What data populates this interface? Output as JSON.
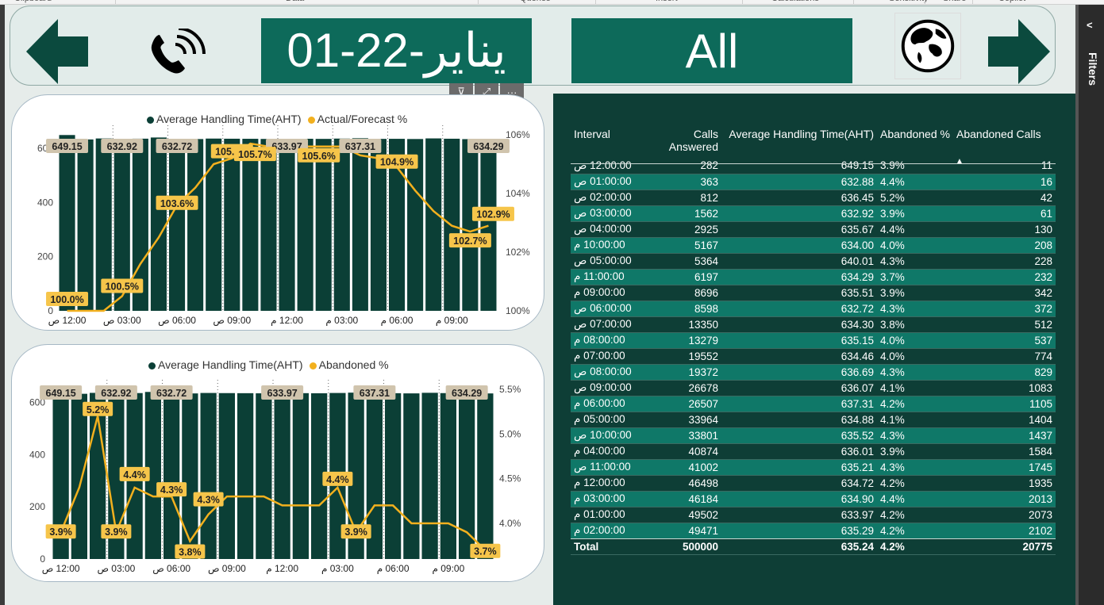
{
  "ribbon": {
    "items": [
      "Clipboard",
      "Data",
      "Queries",
      "Insert",
      "Calculations",
      "Sensitivity",
      "Share",
      "Copilot"
    ]
  },
  "filters_pane": {
    "label": "Filters",
    "chevron": "<"
  },
  "header": {
    "date_text": "يناير-22-01",
    "region_text": "All",
    "icons": {
      "back": "left-arrow-icon",
      "forward": "right-arrow-icon",
      "phone": "phone-icon",
      "globe": "globe-icon"
    }
  },
  "visual_toolbar": {
    "items": [
      {
        "name": "filter-icon",
        "glyph": "⊽"
      },
      {
        "name": "focus-mode-icon",
        "glyph": "⤢"
      },
      {
        "name": "more-options-icon",
        "glyph": "···"
      }
    ]
  },
  "colors": {
    "bar": "#0b3f36",
    "line": "#f2b01e",
    "label_bg_bar": "#d0c4ad",
    "label_bg_line": "#f6c54a",
    "header_box": "#0d6a5a",
    "table_bg": "#0e3e36",
    "table_alt_row": "#0f7868"
  },
  "chart_data": [
    {
      "type": "bar",
      "legend": [
        "Average Handling Time(AHT)",
        "Actual/Forecast %"
      ],
      "categories": [
        "12:00 ص",
        "01:00 ص",
        "02:00 ص",
        "03:00 ص",
        "04:00 ص",
        "05:00 ص",
        "06:00 ص",
        "07:00 ص",
        "08:00 ص",
        "09:00 ص",
        "10:00 ص",
        "11:00 ص",
        "12:00 م",
        "01:00 م",
        "02:00 م",
        "03:00 م",
        "04:00 م",
        "05:00 م",
        "06:00 م",
        "07:00 م",
        "08:00 م",
        "09:00 م",
        "10:00 م",
        "11:00 م"
      ],
      "x_tick_labels": [
        "12:00 ص",
        "03:00 ص",
        "06:00 ص",
        "09:00 ص",
        "12:00 م",
        "03:00 م",
        "06:00 م",
        "09:00 م"
      ],
      "series": [
        {
          "name": "Average Handling Time(AHT)",
          "axis": "left",
          "values": [
            649.15,
            632.88,
            636.45,
            632.92,
            635.67,
            640.01,
            632.72,
            634.3,
            636.07,
            635.52,
            635.21,
            634.72,
            633.97,
            635.29,
            634.9,
            636.01,
            637.31,
            634.88,
            635.15,
            634.46,
            636.69,
            635.51,
            634.0,
            634.29
          ]
        },
        {
          "name": "Actual/Forecast %",
          "axis": "right",
          "values": [
            100.0,
            100.0,
            100.0,
            100.5,
            101.6,
            102.5,
            103.6,
            104.2,
            105.0,
            105.2,
            105.7,
            105.6,
            105.6,
            105.6,
            105.6,
            105.6,
            105.3,
            105.2,
            104.9,
            104.1,
            103.4,
            102.9,
            102.7,
            102.9
          ]
        }
      ],
      "data_labels_bar": [
        [
          0,
          "649.15"
        ],
        [
          3,
          "632.92"
        ],
        [
          6,
          "632.72"
        ],
        [
          12,
          "633.97"
        ],
        [
          16,
          "637.31"
        ],
        [
          23,
          "634.29"
        ]
      ],
      "data_labels_line": [
        [
          0,
          "100.0%"
        ],
        [
          3,
          "100.5%"
        ],
        [
          6,
          "103.6%"
        ],
        [
          9,
          "105.2%"
        ],
        [
          10,
          "105.7%"
        ],
        [
          14,
          "105.6%"
        ],
        [
          18,
          "104.9%"
        ],
        [
          22,
          "102.7%"
        ],
        [
          23,
          "102.9%"
        ]
      ],
      "y_left": {
        "ticks": [
          "0",
          "200",
          "400",
          "600"
        ],
        "range": [
          0,
          650
        ]
      },
      "y_right": {
        "ticks": [
          "100%",
          "102%",
          "104%",
          "106%"
        ],
        "range": [
          100,
          106
        ]
      }
    },
    {
      "type": "bar",
      "legend": [
        "Average Handling Time(AHT)",
        "Abandoned %"
      ],
      "categories": [
        "12:00 ص",
        "01:00 ص",
        "02:00 ص",
        "03:00 ص",
        "04:00 ص",
        "05:00 ص",
        "06:00 ص",
        "07:00 ص",
        "08:00 ص",
        "09:00 ص",
        "10:00 ص",
        "11:00 ص",
        "12:00 م",
        "01:00 م",
        "02:00 م",
        "03:00 م",
        "04:00 م",
        "05:00 م",
        "06:00 م",
        "07:00 م",
        "08:00 م",
        "09:00 م",
        "10:00 م",
        "11:00 م"
      ],
      "x_tick_labels": [
        "12:00 ص",
        "03:00 ص",
        "06:00 ص",
        "09:00 ص",
        "12:00 م",
        "03:00 م",
        "06:00 م",
        "09:00 م"
      ],
      "series": [
        {
          "name": "Average Handling Time(AHT)",
          "axis": "left",
          "values": [
            649.15,
            632.88,
            636.45,
            632.92,
            635.67,
            640.01,
            632.72,
            634.3,
            636.07,
            635.52,
            635.21,
            634.72,
            633.97,
            635.29,
            634.9,
            636.01,
            637.31,
            634.88,
            635.15,
            634.46,
            636.69,
            635.51,
            634.0,
            634.29
          ]
        },
        {
          "name": "Abandoned %",
          "axis": "right",
          "values": [
            3.9,
            4.4,
            5.2,
            3.9,
            4.4,
            4.3,
            4.3,
            3.8,
            4.1,
            4.3,
            4.3,
            4.3,
            4.2,
            4.2,
            4.2,
            4.4,
            3.9,
            4.2,
            4.2,
            4.0,
            4.0,
            4.0,
            3.9,
            3.7
          ]
        }
      ],
      "data_labels_bar": [
        [
          0,
          "649.15"
        ],
        [
          3,
          "632.92"
        ],
        [
          6,
          "632.72"
        ],
        [
          12,
          "633.97"
        ],
        [
          17,
          "637.31"
        ],
        [
          22,
          "634.29"
        ]
      ],
      "data_labels_line": [
        [
          0,
          "3.9%"
        ],
        [
          2,
          "5.2%"
        ],
        [
          3,
          "3.9%"
        ],
        [
          4,
          "4.4%"
        ],
        [
          6,
          "4.3%"
        ],
        [
          7,
          "3.8%"
        ],
        [
          8,
          "4.3%"
        ],
        [
          15,
          "4.4%"
        ],
        [
          16,
          "3.9%"
        ],
        [
          23,
          "3.7%"
        ]
      ],
      "y_left": {
        "ticks": [
          "0",
          "200",
          "400",
          "600"
        ],
        "range": [
          0,
          650
        ]
      },
      "y_right": {
        "ticks": [
          "4.0%",
          "4.5%",
          "5.0%",
          "5.5%"
        ],
        "range": [
          3.6,
          5.5
        ]
      }
    }
  ],
  "table": {
    "headers": [
      "Interval",
      "Calls Answered",
      "Average Handling Time(AHT)",
      "Abandoned %",
      "Abandoned Calls"
    ],
    "sort_indicator": "▲",
    "rows": [
      [
        "12:00:00 ص",
        "282",
        "649.15",
        "3.9%",
        "11"
      ],
      [
        "01:00:00 ص",
        "363",
        "632.88",
        "4.4%",
        "16"
      ],
      [
        "02:00:00 ص",
        "812",
        "636.45",
        "5.2%",
        "42"
      ],
      [
        "03:00:00 ص",
        "1562",
        "632.92",
        "3.9%",
        "61"
      ],
      [
        "04:00:00 ص",
        "2925",
        "635.67",
        "4.4%",
        "130"
      ],
      [
        "10:00:00 م",
        "5167",
        "634.00",
        "4.0%",
        "208"
      ],
      [
        "05:00:00 ص",
        "5364",
        "640.01",
        "4.3%",
        "228"
      ],
      [
        "11:00:00 م",
        "6197",
        "634.29",
        "3.7%",
        "232"
      ],
      [
        "09:00:00 م",
        "8696",
        "635.51",
        "3.9%",
        "342"
      ],
      [
        "06:00:00 ص",
        "8598",
        "632.72",
        "4.3%",
        "372"
      ],
      [
        "07:00:00 ص",
        "13350",
        "634.30",
        "3.8%",
        "512"
      ],
      [
        "08:00:00 م",
        "13279",
        "635.15",
        "4.0%",
        "537"
      ],
      [
        "07:00:00 م",
        "19552",
        "634.46",
        "4.0%",
        "774"
      ],
      [
        "08:00:00 ص",
        "19372",
        "636.69",
        "4.3%",
        "829"
      ],
      [
        "09:00:00 ص",
        "26678",
        "636.07",
        "4.1%",
        "1083"
      ],
      [
        "06:00:00 م",
        "26507",
        "637.31",
        "4.2%",
        "1105"
      ],
      [
        "05:00:00 م",
        "33964",
        "634.88",
        "4.1%",
        "1404"
      ],
      [
        "10:00:00 ص",
        "33801",
        "635.52",
        "4.3%",
        "1437"
      ],
      [
        "04:00:00 م",
        "40874",
        "636.01",
        "3.9%",
        "1584"
      ],
      [
        "11:00:00 ص",
        "41002",
        "635.21",
        "4.3%",
        "1745"
      ],
      [
        "12:00:00 م",
        "46498",
        "634.72",
        "4.2%",
        "1935"
      ],
      [
        "03:00:00 م",
        "46184",
        "634.90",
        "4.4%",
        "2013"
      ],
      [
        "01:00:00 م",
        "49502",
        "633.97",
        "4.2%",
        "2073"
      ],
      [
        "02:00:00 م",
        "49471",
        "635.29",
        "4.2%",
        "2102"
      ]
    ],
    "total": [
      "Total",
      "500000",
      "635.24",
      "4.2%",
      "20775"
    ]
  }
}
